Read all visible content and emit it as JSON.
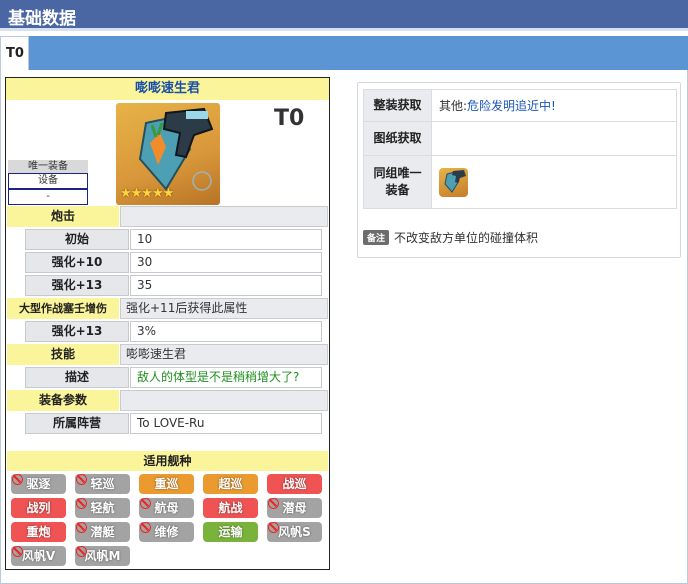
{
  "page": {
    "title": "基础数据"
  },
  "tabs": [
    {
      "label": "T0"
    }
  ],
  "card": {
    "name": "嘭嘭速生君",
    "tier": "T0",
    "stars": "★★★★★",
    "unique": {
      "label": "唯一装备",
      "value": "设备",
      "extra": "-"
    },
    "sections": {
      "cannon": {
        "label": "炮击",
        "value": ""
      },
      "cannon_rows": [
        {
          "label": "初始",
          "value": "10"
        },
        {
          "label": "强化+10",
          "value": "30"
        },
        {
          "label": "强化+13",
          "value": "35"
        }
      ],
      "bonus": {
        "label": "大型作战塞壬增伤",
        "value": "强化+11后获得此属性"
      },
      "bonus_rows": [
        {
          "label": "强化+13",
          "value": "3%"
        }
      ],
      "skill": {
        "label": "技能",
        "value": "嘭嘭速生君"
      },
      "skill_rows": [
        {
          "label": "描述",
          "value": "敌人的体型是不是稍稍增大了?"
        }
      ],
      "params": {
        "label": "装备参数",
        "value": ""
      },
      "param_rows": [
        {
          "label": "所属阵营",
          "value": "To LOVE-Ru"
        }
      ]
    },
    "ships_header": "适用舰种",
    "ships": [
      {
        "label": "驱逐",
        "color": "#a3a3a3",
        "allowed": false
      },
      {
        "label": "轻巡",
        "color": "#a3a3a3",
        "allowed": false
      },
      {
        "label": "重巡",
        "color": "#ea9a2f",
        "allowed": true
      },
      {
        "label": "超巡",
        "color": "#ea9a2f",
        "allowed": true
      },
      {
        "label": "战巡",
        "color": "#ef5353",
        "allowed": true
      },
      {
        "label": "战列",
        "color": "#ef5353",
        "allowed": true
      },
      {
        "label": "轻航",
        "color": "#a3a3a3",
        "allowed": false
      },
      {
        "label": "航母",
        "color": "#a3a3a3",
        "allowed": false
      },
      {
        "label": "航战",
        "color": "#ef5353",
        "allowed": true
      },
      {
        "label": "潜母",
        "color": "#a3a3a3",
        "allowed": false
      },
      {
        "label": "重炮",
        "color": "#ef5353",
        "allowed": true
      },
      {
        "label": "潜艇",
        "color": "#a3a3a3",
        "allowed": false
      },
      {
        "label": "维修",
        "color": "#a3a3a3",
        "allowed": false
      },
      {
        "label": "运输",
        "color": "#7ab33c",
        "allowed": true
      },
      {
        "label": "风帆S",
        "color": "#a3a3a3",
        "allowed": false
      },
      {
        "label": "风帆V",
        "color": "#a3a3a3",
        "allowed": false
      },
      {
        "label": "风帆M",
        "color": "#a3a3a3",
        "allowed": false
      }
    ]
  },
  "side": {
    "rows": [
      {
        "label": "整装获取",
        "prefix": "其他:",
        "link": "危险发明追近中!"
      },
      {
        "label": "图纸获取",
        "prefix": "",
        "link": ""
      },
      {
        "label": "同组唯一装备",
        "prefix": "",
        "link": ""
      }
    ],
    "note_badge": "备注",
    "note_text": "不改变敌方单位的碰撞体积"
  }
}
